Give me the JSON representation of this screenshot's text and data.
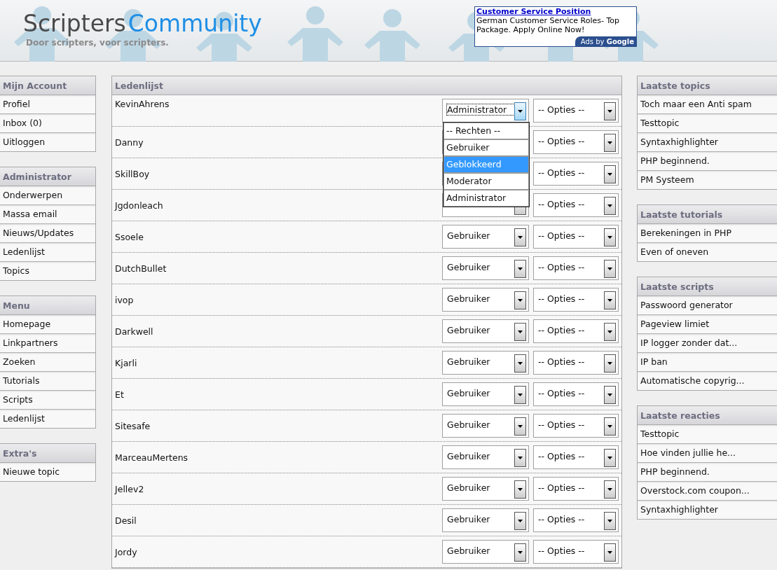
{
  "header": {
    "logo_first": "Scripters",
    "logo_second": "Community",
    "tagline": "Door scripters, voor scripters."
  },
  "ad": {
    "title": "Customer Service Position",
    "body": "German Customer Service Roles- Top Package. Apply Online Now!",
    "attribution_prefix": "Ads by",
    "attribution_brand": "Google"
  },
  "left_sidebar": [
    {
      "title": "Mijn Account",
      "items": [
        "Profiel",
        "Inbox (0)",
        "Uitloggen"
      ]
    },
    {
      "title": "Administrator",
      "items": [
        "Onderwerpen",
        "Massa email",
        "Nieuws/Updates",
        "Ledenlijst",
        "Topics"
      ]
    },
    {
      "title": "Menu",
      "items": [
        "Homepage",
        "Linkpartners",
        "Zoeken",
        "Tutorials",
        "Scripts",
        "Ledenlijst"
      ]
    },
    {
      "title": "Extra's",
      "items": [
        "Nieuwe topic"
      ]
    }
  ],
  "members": {
    "title": "Ledenlijst",
    "rows": [
      {
        "name": "KevinAhrens",
        "role": "Administrator",
        "options": "-- Opties --",
        "focused": true
      },
      {
        "name": "Danny",
        "options": "-- Opties --"
      },
      {
        "name": "SkillBoy",
        "options": "-- Opties --"
      },
      {
        "name": "Jgdonleach",
        "options": "-- Opties --"
      },
      {
        "name": "Ssoele",
        "role": "Gebruiker",
        "options": "-- Opties --",
        "focused": false
      },
      {
        "name": "DutchBullet",
        "role": "Gebruiker",
        "options": "-- Opties --",
        "focused": false
      },
      {
        "name": "ivop",
        "role": "Gebruiker",
        "options": "-- Opties --",
        "focused": false
      },
      {
        "name": "Darkwell",
        "role": "Gebruiker",
        "options": "-- Opties --",
        "focused": false
      },
      {
        "name": "Kjarli",
        "role": "Gebruiker",
        "options": "-- Opties --",
        "focused": false
      },
      {
        "name": "Et",
        "role": "Gebruiker",
        "options": "-- Opties --",
        "focused": false
      },
      {
        "name": "Sitesafe",
        "role": "Gebruiker",
        "options": "-- Opties --",
        "focused": false
      },
      {
        "name": "MarceauMertens",
        "role": "Gebruiker",
        "options": "-- Opties --",
        "focused": false
      },
      {
        "name": "Jellev2",
        "role": "Gebruiker",
        "options": "-- Opties --",
        "focused": false
      },
      {
        "name": "Desil",
        "role": "Gebruiker",
        "options": "-- Opties --",
        "focused": false
      },
      {
        "name": "Jordy",
        "role": "Gebruiker",
        "options": "-- Opties --",
        "focused": false
      }
    ]
  },
  "role_dropdown": {
    "expanded": true,
    "options": [
      {
        "label": "-- Rechten --",
        "selected": false
      },
      {
        "label": "Gebruiker",
        "selected": false
      },
      {
        "label": "Geblokkeerd",
        "selected": true
      },
      {
        "label": "Moderator",
        "selected": false
      },
      {
        "label": "Administrator",
        "selected": false
      }
    ]
  },
  "right_sidebar": [
    {
      "title": "Laatste topics",
      "items": [
        "Toch maar een Anti spam",
        "Testtopic",
        "Syntaxhighlighter",
        "PHP beginnend.",
        "PM Systeem"
      ]
    },
    {
      "title": "Laatste tutorials",
      "items": [
        "Berekeningen in PHP",
        "Even of oneven"
      ]
    },
    {
      "title": "Laatste scripts",
      "items": [
        "Passwoord generator",
        "Pageview limiet",
        "IP logger zonder dat...",
        "IP ban",
        "Automatische copyrig..."
      ]
    },
    {
      "title": "Laatste reacties",
      "items": [
        "Testtopic",
        "Hoe vinden jullie he...",
        "PHP beginnend.",
        "Overstock.com coupon...",
        "Syntaxhighlighter"
      ]
    }
  ]
}
